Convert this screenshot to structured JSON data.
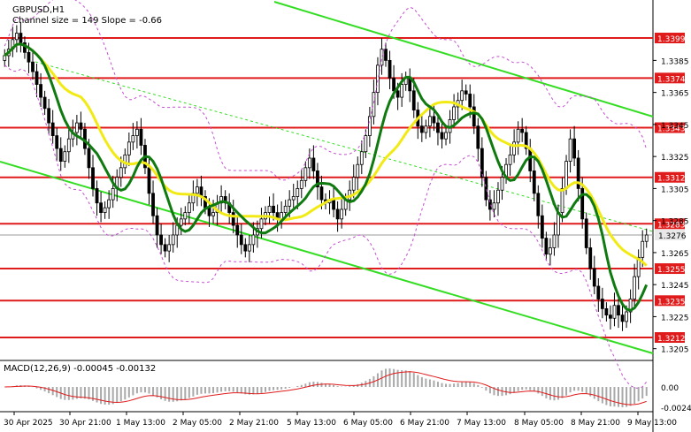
{
  "header": {
    "title": "GBPUSD,H1",
    "subtitle": "Channel size = 149 Slope = -0.66"
  },
  "macd_header": "MACD(12,26,9) -0.00045 -0.00132",
  "colors": {
    "level_line": "#e01b1b",
    "price_tag": "#e01b1b",
    "channel": "#33dd22",
    "ma_fast": "#0f7a0f",
    "ma_slow": "#f2ea14",
    "bollinger": "#c44fd1",
    "candle": "#000000",
    "macd_hist": "#a9a9a9",
    "macd_signal": "#e01b1b",
    "current_price_bg": "#e8e8e8"
  },
  "chart_data": [
    {
      "type": "candlestick",
      "symbol": "GBPUSD",
      "timeframe": "H1",
      "y_ticks": [
        1.3385,
        1.3365,
        1.3345,
        1.3325,
        1.3305,
        1.3285,
        1.3265,
        1.3245,
        1.3225,
        1.3205
      ],
      "y_tick_labels": [
        "1.3385",
        "1.3365",
        "1.3345",
        "1.3325",
        "1.3305",
        "1.3285",
        "1.3265",
        "1.3245",
        "1.3225",
        "1.3205"
      ],
      "ylim": [
        1.3197,
        1.3412
      ],
      "x_tick_labels": [
        "30 Apr 2025",
        "30 Apr 21:00",
        "1 May 13:00",
        "2 May 05:00",
        "2 May 21:00",
        "5 May 13:00",
        "6 May 05:00",
        "6 May 21:00",
        "7 May 13:00",
        "8 May 05:00",
        "8 May 21:00",
        "9 May 13:00"
      ],
      "levels": [
        {
          "label": "1.3399",
          "value": 1.3399
        },
        {
          "label": "1.3374",
          "value": 1.3374
        },
        {
          "label": "1.3343",
          "value": 1.3343
        },
        {
          "label": "1.3312",
          "value": 1.3312
        },
        {
          "label": "1.3283",
          "value": 1.3283
        },
        {
          "label": "1.3255",
          "value": 1.3255
        },
        {
          "label": "1.3235",
          "value": 1.3235
        },
        {
          "label": "1.3212",
          "value": 1.3212
        }
      ],
      "current_price": {
        "label": "1.3276",
        "value": 1.3276
      },
      "ohlc_close": [
        1.3388,
        1.3392,
        1.3398,
        1.3402,
        1.3396,
        1.339,
        1.3384,
        1.3378,
        1.337,
        1.3362,
        1.3355,
        1.3346,
        1.3338,
        1.333,
        1.3322,
        1.3328,
        1.3336,
        1.334,
        1.3346,
        1.3342,
        1.333,
        1.3318,
        1.3305,
        1.3296,
        1.329,
        1.3293,
        1.3298,
        1.3305,
        1.3312,
        1.3318,
        1.3326,
        1.3334,
        1.3338,
        1.3342,
        1.3332,
        1.3318,
        1.3302,
        1.3288,
        1.3276,
        1.327,
        1.3266,
        1.327,
        1.3276,
        1.3282,
        1.3286,
        1.329,
        1.3296,
        1.3302,
        1.3306,
        1.33,
        1.3293,
        1.3288,
        1.329,
        1.3296,
        1.33,
        1.3296,
        1.329,
        1.3282,
        1.3276,
        1.327,
        1.3266,
        1.327,
        1.3276,
        1.328,
        1.3286,
        1.329,
        1.3294,
        1.329,
        1.3286,
        1.329,
        1.3294,
        1.3298,
        1.33,
        1.3305,
        1.331,
        1.3318,
        1.3324,
        1.3316,
        1.3306,
        1.3298,
        1.3296,
        1.3298,
        1.3292,
        1.3286,
        1.3292,
        1.3298,
        1.3304,
        1.3312,
        1.332,
        1.3328,
        1.3338,
        1.335,
        1.3365,
        1.3382,
        1.3392,
        1.3385,
        1.3374,
        1.3366,
        1.3362,
        1.337,
        1.3374,
        1.3366,
        1.3354,
        1.3344,
        1.334,
        1.3344,
        1.335,
        1.3346,
        1.334,
        1.3336,
        1.334,
        1.3348,
        1.3356,
        1.336,
        1.3366,
        1.3364,
        1.3356,
        1.3344,
        1.333,
        1.3312,
        1.3298,
        1.3292,
        1.3296,
        1.3304,
        1.3312,
        1.332,
        1.3326,
        1.3334,
        1.3342,
        1.334,
        1.333,
        1.3316,
        1.3302,
        1.3288,
        1.3274,
        1.3264,
        1.3268,
        1.3276,
        1.329,
        1.3305,
        1.3322,
        1.3336,
        1.3324,
        1.3305,
        1.3286,
        1.3268,
        1.3255,
        1.3244,
        1.3236,
        1.323,
        1.3226,
        1.3224,
        1.3232,
        1.3226,
        1.3222,
        1.3228,
        1.3236,
        1.325,
        1.3262,
        1.3272,
        1.3276
      ]
    },
    {
      "type": "line",
      "name": "MACD(12,26,9)",
      "values_printed": [
        -0.00045,
        -0.00132
      ],
      "y_tick_labels": [
        "0.00",
        "-0.00242"
      ],
      "ylim": [
        -0.0034,
        0.0024
      ]
    }
  ]
}
